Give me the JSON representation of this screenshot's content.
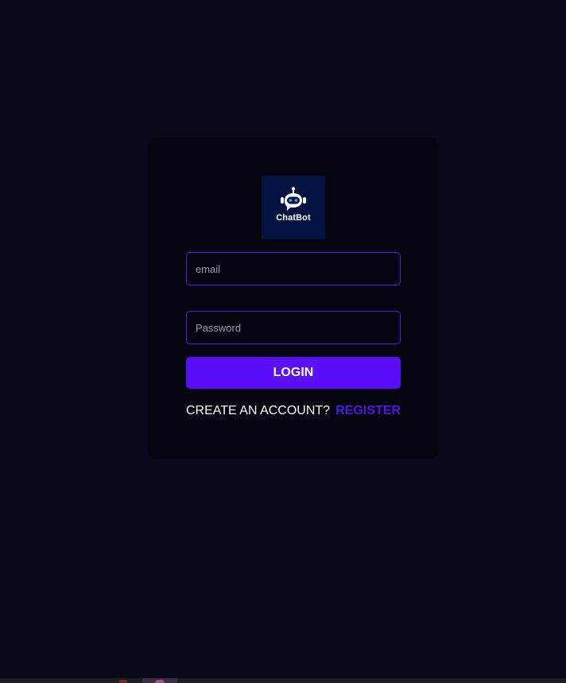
{
  "logo": {
    "text": "ChatBot",
    "icon": "robot-chat-icon"
  },
  "form": {
    "email": {
      "placeholder": "email",
      "value": ""
    },
    "password": {
      "placeholder": "Password",
      "value": ""
    },
    "login_label": "LOGIN",
    "create_account_text": "CREATE AN ACCOUNT?",
    "register_label": "REGISTER"
  },
  "colors": {
    "page_background": "#080a1b",
    "card_background": "#04050e",
    "accent": "#5a0ff8",
    "input_border": "#5b16f0",
    "logo_background": "#021342"
  }
}
